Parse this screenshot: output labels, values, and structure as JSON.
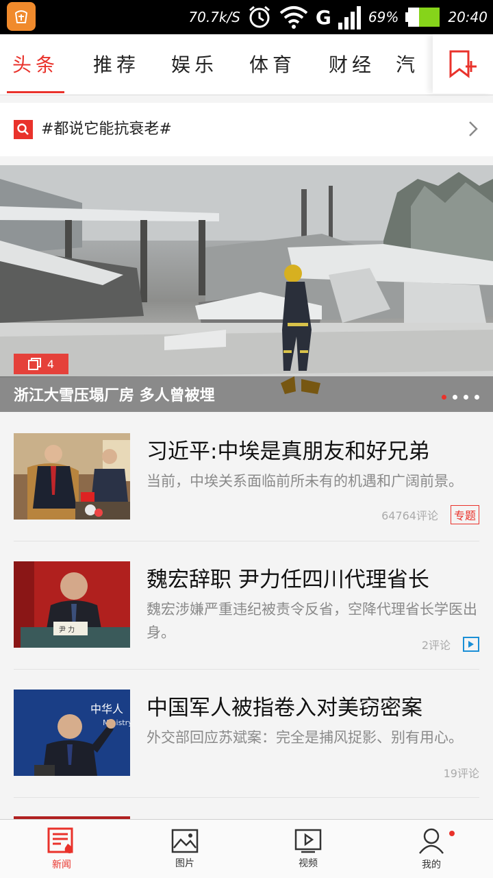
{
  "status_bar": {
    "net_speed": "70.7k/S",
    "signal": "G",
    "battery": "69%",
    "time": "20:40",
    "icons": [
      "app-icon",
      "alarm-icon",
      "wifi-icon",
      "cell-signal-icon",
      "battery-icon"
    ]
  },
  "tabs": [
    {
      "label": "头条",
      "active": true
    },
    {
      "label": "推荐",
      "active": false
    },
    {
      "label": "娱乐",
      "active": false
    },
    {
      "label": "体育",
      "active": false
    },
    {
      "label": "财经",
      "active": false
    },
    {
      "label": "汽",
      "active": false
    }
  ],
  "search": {
    "text": "#都说它能抗衰老#"
  },
  "hero": {
    "title": "浙江大雪压塌厂房 多人曾被埋",
    "photo_count": "4",
    "slide_count": 4,
    "active_slide": 1
  },
  "news": [
    {
      "title": "习近平:中埃是真朋友和好兄弟",
      "digest": "当前，中埃关系面临前所未有的机遇和广阔前景。",
      "comments": "64764评论",
      "tag": "专题"
    },
    {
      "title": "魏宏辞职 尹力任四川代理省长",
      "digest": "魏宏涉嫌严重违纪被责令反省，空降代理省长学医出身。",
      "comments": "2评论",
      "tag": "video"
    },
    {
      "title": "中国军人被指卷入对美窃密案",
      "digest": "外交部回应苏斌案：完全是捕风捉影、别有用心。",
      "comments": "19评论",
      "tag": ""
    }
  ],
  "thumb_texts": {
    "nameplate": "尹 力",
    "backdrop": "中华人",
    "backdrop2": "Ministry"
  },
  "bottom_nav": [
    {
      "label": "新闻",
      "icon": "news-icon",
      "active": true
    },
    {
      "label": "图片",
      "icon": "picture-icon",
      "active": false
    },
    {
      "label": "视频",
      "icon": "video-icon",
      "active": false
    },
    {
      "label": "我的",
      "icon": "profile-icon",
      "active": false,
      "badge": true
    }
  ],
  "colors": {
    "accent": "#e9322b",
    "video_blue": "#1a8fd6"
  }
}
